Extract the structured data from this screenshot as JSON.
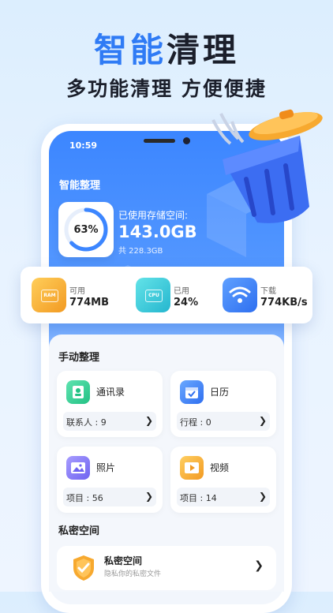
{
  "hero": {
    "title_accent": "智能",
    "title_rest": "清理",
    "subtitle": "多功能清理 方便便捷"
  },
  "status_bar": {
    "time": "10:59"
  },
  "app": {
    "title": "智能整理"
  },
  "storage": {
    "percent_label": "63%",
    "percent_value": 0.63,
    "used_label": "已使用存储空间:",
    "used_value": "143.0GB",
    "total": "共 228.3GB"
  },
  "stats": [
    {
      "icon": "ram-icon",
      "chip": "RAM",
      "label": "可用",
      "value": "774MB",
      "color": "#f7a92f"
    },
    {
      "icon": "cpu-icon",
      "chip": "CPU",
      "label": "已用",
      "value": "24%",
      "color": "#39c8d8"
    },
    {
      "icon": "wifi-icon",
      "chip": "",
      "label": "下载",
      "value": "774KB/s",
      "color": "#3c86ff"
    }
  ],
  "manual": {
    "title": "手动整理",
    "cards": [
      {
        "icon": "contacts-icon",
        "title": "通讯录",
        "info": "联系人 : 9",
        "color": "#2ecf8f"
      },
      {
        "icon": "calendar-icon",
        "title": "日历",
        "info": "行程 : 0",
        "color": "#3c86ff"
      },
      {
        "icon": "photos-icon",
        "title": "照片",
        "info": "项目 : 56",
        "color": "#8a7cff"
      },
      {
        "icon": "video-icon",
        "title": "视频",
        "info": "项目 : 14",
        "color": "#f7a92f"
      }
    ]
  },
  "private": {
    "section_title": "私密空间",
    "title": "私密空间",
    "subtitle": "隐私你的私密文件",
    "icon": "shield-check-icon"
  },
  "colors": {
    "accent": "#2f7bf5",
    "dark": "#1b1f2b"
  }
}
